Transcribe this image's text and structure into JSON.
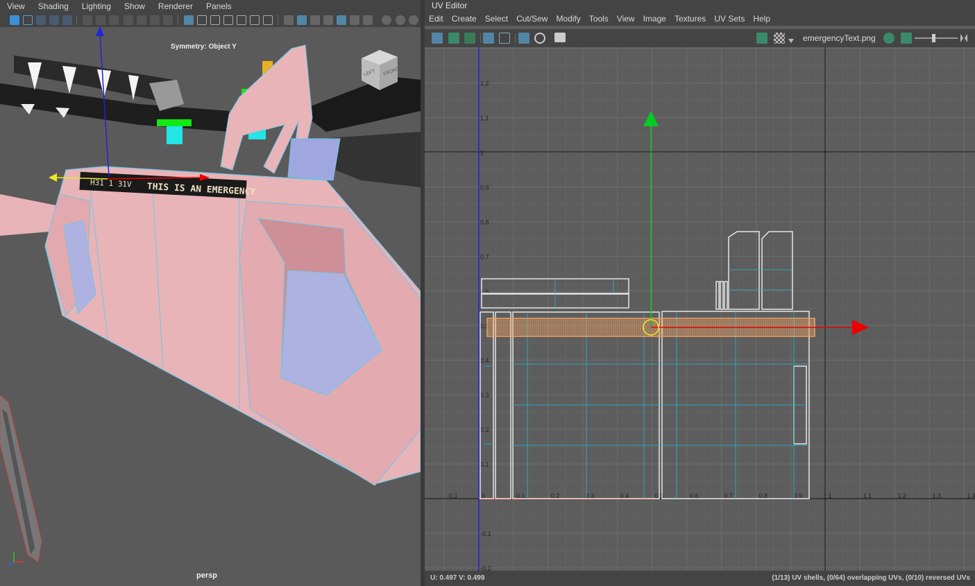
{
  "viewport": {
    "menu": [
      "View",
      "Shading",
      "Lighting",
      "Show",
      "Renderer",
      "Panels"
    ],
    "symmetry_label": "Symmetry: Object Y",
    "camera_label": "persp",
    "viewcube": {
      "left": "LEFT",
      "front": "FRONT"
    },
    "sign_text": "THIS IS AN EMERGENCY",
    "sign_text_prefix": "H31 1 31V"
  },
  "uv_editor": {
    "title": "UV Editor",
    "menu": [
      "Edit",
      "Create",
      "Select",
      "Cut/Sew",
      "Modify",
      "Tools",
      "View",
      "Image",
      "Textures",
      "UV Sets",
      "Help"
    ],
    "image_name": "emergencyText.png",
    "status_left": "U: 0.497 V:  0.499",
    "status_right": "(1/13) UV shells, (0/64) overlapping UVs, (0/10) reversed UVs",
    "x_ticks": [
      "-0.1",
      "0",
      "0.1",
      "0.2",
      "0.3",
      "0.4",
      "0.5",
      "0.6",
      "0.7",
      "0.8",
      "0.9",
      "1",
      "1.1",
      "1.2",
      "1.3",
      "1.4"
    ],
    "y_ticks": [
      "-0.2",
      "-0.1",
      "0",
      "0.1",
      "0.2",
      "0.3",
      "0.4",
      "0.5",
      "0.6",
      "0.7",
      "0.8",
      "0.9",
      "1",
      "1.1",
      "1.2"
    ]
  },
  "colors": {
    "mesh_pink": "#e8b4b8",
    "wire_blue": "#6ec6e6",
    "selected_orange": "#f0a060",
    "axis_green": "#00cc22",
    "axis_red": "#ee0000",
    "axis_blue": "#2222dd"
  }
}
